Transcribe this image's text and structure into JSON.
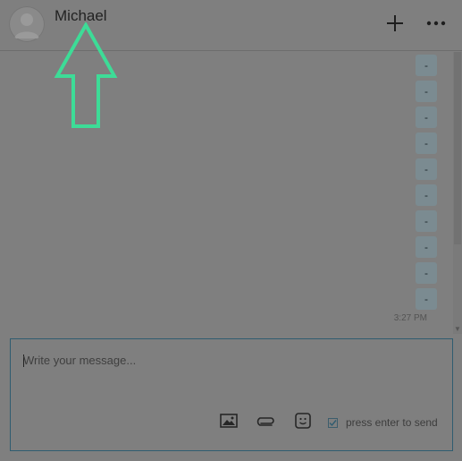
{
  "chat": {
    "contact_name": "Michael"
  },
  "header": {
    "icons": [
      "user-avatar-icon",
      "plus-icon",
      "more-dots-icon"
    ]
  },
  "messages": {
    "bubbles": [
      "-",
      "-",
      "-",
      "-",
      "-",
      "-",
      "-",
      "-",
      "-",
      "-"
    ],
    "timestamp": "3:27 PM"
  },
  "composer": {
    "placeholder": "Write your message...",
    "value": "",
    "tools": [
      "image-icon",
      "paperclip-icon",
      "emoji-icon"
    ],
    "enter_to_send_label": "press enter to send",
    "enter_to_send_checked": true
  },
  "colors": {
    "overlay": "#7f7f7f",
    "annotation_arrow": "#3ddc97",
    "composer_border": "#2f5c70",
    "bubble": "#7b8b91"
  }
}
